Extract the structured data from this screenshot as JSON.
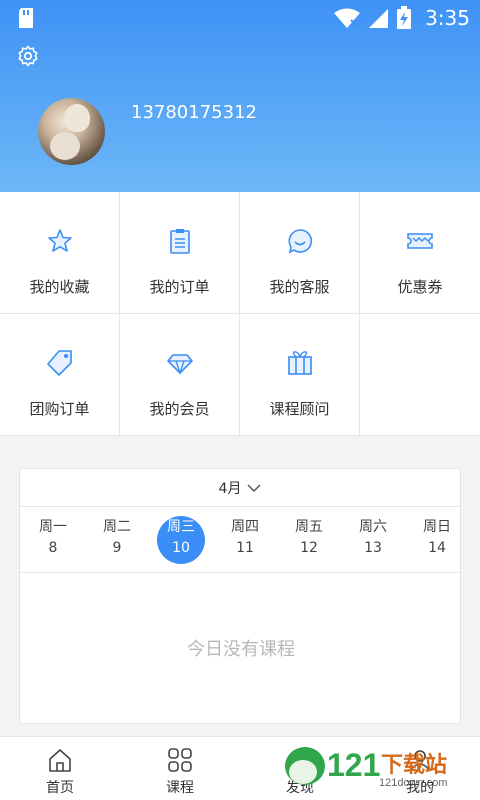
{
  "status_bar": {
    "time": "3:35"
  },
  "profile": {
    "phone": "13780175312"
  },
  "menu": [
    {
      "label": "我的收藏",
      "icon": "star-icon"
    },
    {
      "label": "我的订单",
      "icon": "clipboard-icon"
    },
    {
      "label": "我的客服",
      "icon": "chat-icon"
    },
    {
      "label": "优惠券",
      "icon": "coupon-icon"
    },
    {
      "label": "团购订单",
      "icon": "tag-icon"
    },
    {
      "label": "我的会员",
      "icon": "diamond-icon"
    },
    {
      "label": "课程顾问",
      "icon": "gift-icon"
    }
  ],
  "calendar": {
    "month": "4月",
    "days": [
      {
        "weekday": "周一",
        "date": "8"
      },
      {
        "weekday": "周二",
        "date": "9"
      },
      {
        "weekday": "周三",
        "date": "10"
      },
      {
        "weekday": "周四",
        "date": "11"
      },
      {
        "weekday": "周五",
        "date": "12"
      },
      {
        "weekday": "周六",
        "date": "13"
      },
      {
        "weekday": "周日",
        "date": "14"
      }
    ],
    "selected_index": 2,
    "empty_text": "今日没有课程"
  },
  "tabs": [
    {
      "label": "首页",
      "icon": "home-icon"
    },
    {
      "label": "课程",
      "icon": "grid-icon"
    },
    {
      "label": "发现",
      "icon": "compass-icon"
    },
    {
      "label": "我的",
      "icon": "user-icon"
    }
  ],
  "watermark": {
    "text": "121下载站",
    "sub": "121down.com"
  },
  "colors": {
    "accent": "#3a8ef5",
    "header_top": "#3f92f6",
    "header_bottom": "#6db8f7"
  }
}
